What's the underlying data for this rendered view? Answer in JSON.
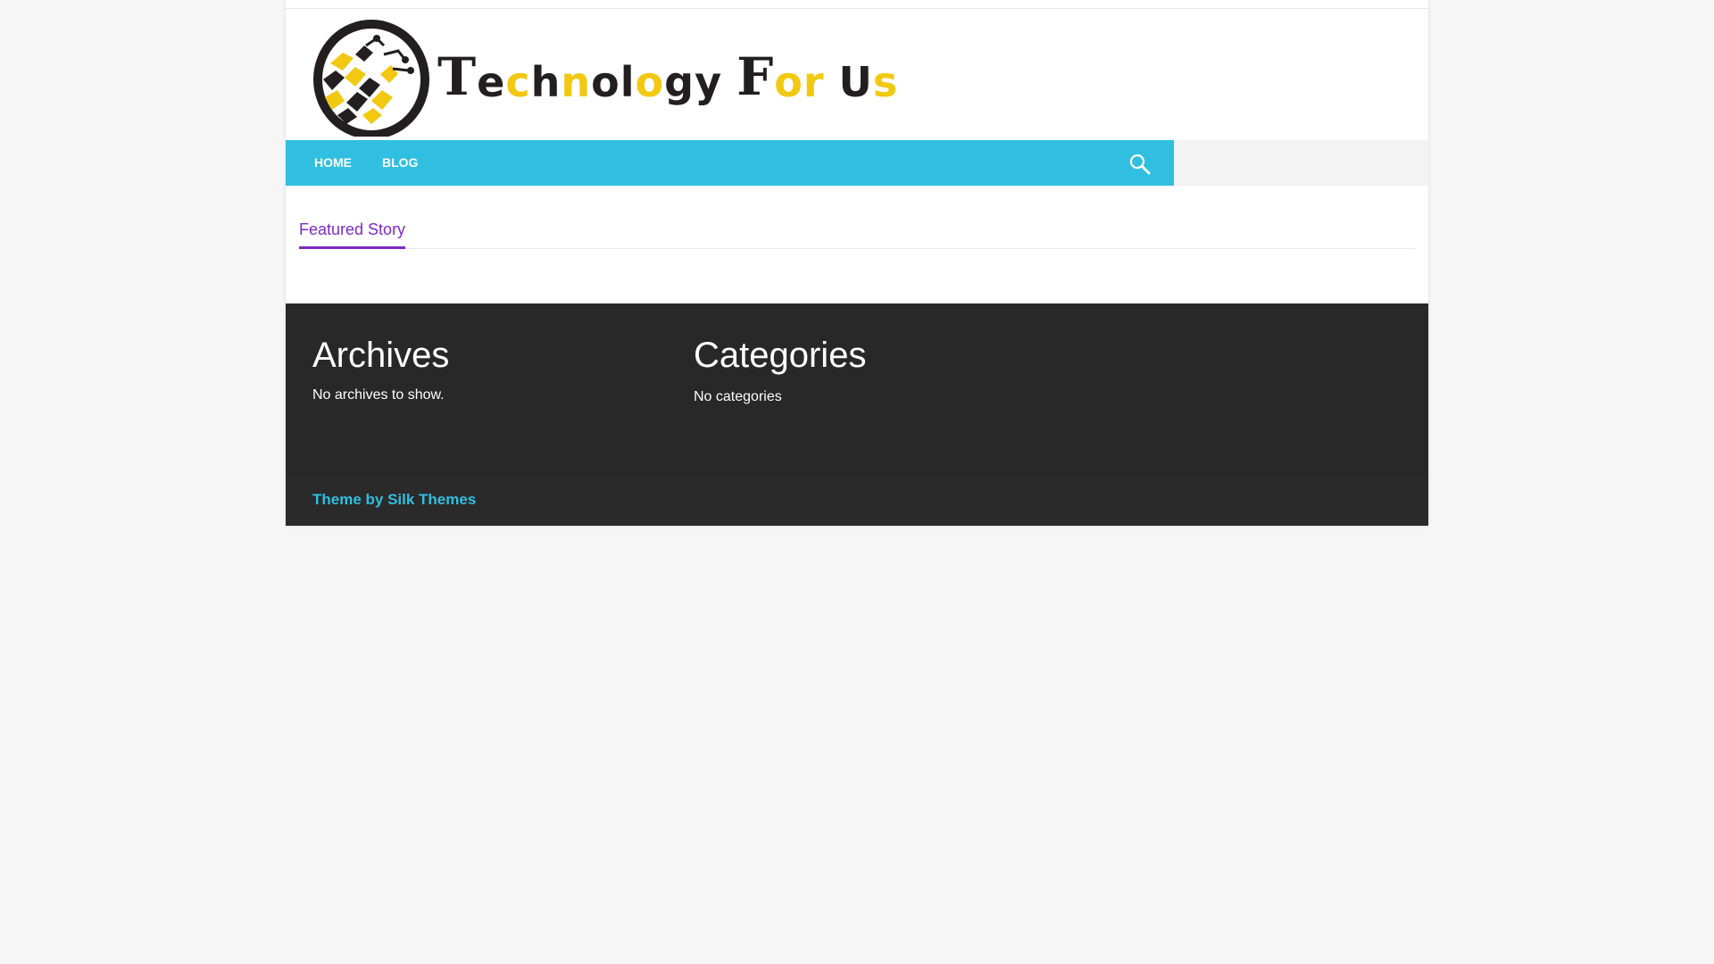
{
  "site": {
    "logo_text": {
      "t": "T",
      "part1_dark": "e",
      "part1_yellow": "c",
      "part2_dark": "h",
      "part2_yellow": "n",
      "part3_dark": "ol",
      "part3_yellow": "o",
      "part4_dark": "gy",
      "f": "F",
      "or": "or",
      "u": "U",
      "s": "s"
    },
    "logo_icon": "globe-circuit-logo",
    "colors": {
      "nav": "#30bfe0",
      "accent": "#7e2ac6",
      "footer": "#282828",
      "logo_yellow": "#f2c811",
      "logo_dark": "#231f20"
    }
  },
  "nav": {
    "items": [
      {
        "label": "HOME"
      },
      {
        "label": "BLOG"
      }
    ],
    "search_icon": "search-icon"
  },
  "main": {
    "featured_title": "Featured Story"
  },
  "footer": {
    "archives": {
      "title": "Archives",
      "text": "No archives to show."
    },
    "categories": {
      "title": "Categories",
      "text": "No categories"
    },
    "credit": "Theme by Silk Themes"
  }
}
